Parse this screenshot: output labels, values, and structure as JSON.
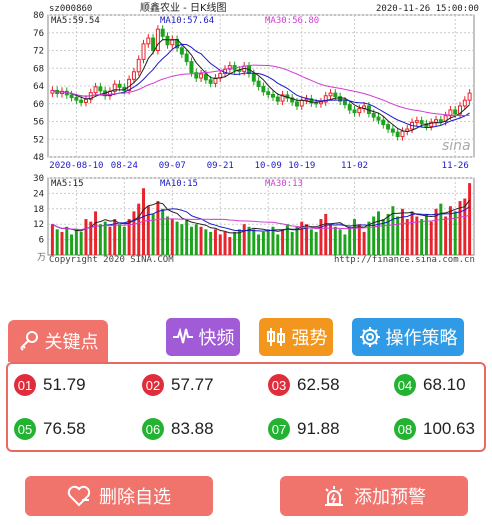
{
  "chart": {
    "symbol": "sz000860",
    "title": "顺鑫农业 - 日K线图",
    "datetime": "2020-11-26 15:00:00",
    "ma5_label": "MA5:59.54",
    "ma10_label": "MA10:57.64",
    "ma30_label": "MA30:56.80",
    "vol_ma5_label": "MA5:15",
    "vol_ma10_label": "MA10:15",
    "vol_ma30_label": "MA30:13",
    "vol_unit": "万",
    "copyright": "Copyright 2020 SINA.COM",
    "source_url": "http://finance.sina.com.cn",
    "watermark": "sina",
    "price_ticks": [
      "80",
      "76",
      "72",
      "68",
      "64",
      "60",
      "56",
      "52",
      "48"
    ],
    "volume_ticks": [
      "30",
      "24",
      "18",
      "12",
      "6"
    ],
    "date_ticks": [
      "2020-08-10",
      "08-24",
      "09-07",
      "09-21",
      "10-09",
      "10-19",
      "11-02",
      "11-26"
    ],
    "colors": {
      "up": "#e8232b",
      "down": "#1ca21c",
      "ma5": "#222222",
      "ma10": "#1a1ac8",
      "ma30": "#d23cd2"
    }
  },
  "chart_data": {
    "type": "candlestick",
    "title": "顺鑫农业 - 日K线图",
    "ylim_price": [
      48,
      80
    ],
    "ylim_volume": [
      0,
      30
    ],
    "close": [
      63.0,
      62.3,
      62.8,
      62.0,
      61.4,
      60.8,
      60.3,
      61.0,
      62.5,
      63.8,
      62.9,
      61.8,
      62.8,
      64.4,
      63.7,
      63.0,
      65.5,
      67.2,
      70.0,
      73.5,
      74.8,
      72.0,
      76.8,
      75.2,
      73.3,
      74.5,
      72.6,
      71.2,
      69.5,
      67.0,
      65.8,
      66.7,
      65.4,
      64.6,
      65.8,
      66.8,
      67.8,
      68.6,
      67.6,
      67.3,
      68.5,
      66.8,
      65.1,
      63.9,
      62.7,
      62.1,
      61.5,
      60.6,
      62.0,
      61.3,
      60.4,
      59.5,
      60.8,
      61.1,
      60.2,
      60.0,
      60.4,
      61.8,
      62.4,
      61.6,
      60.6,
      59.8,
      58.6,
      58.0,
      58.9,
      59.5,
      57.8,
      57.0,
      56.3,
      55.3,
      54.3,
      53.6,
      52.6,
      53.8,
      54.3,
      55.8,
      56.2,
      55.5,
      54.9,
      55.8,
      56.4,
      56.0,
      57.3,
      58.6,
      57.7,
      59.5,
      60.8,
      62.4
    ],
    "volume": [
      12,
      10,
      9,
      11,
      8,
      10,
      9,
      14,
      13,
      17,
      12,
      13,
      11,
      14,
      12,
      11,
      14,
      17,
      20,
      26,
      19,
      16,
      21,
      18,
      15,
      14,
      13,
      12,
      14,
      11,
      12,
      11,
      10,
      9,
      10,
      8,
      9,
      7,
      9,
      10,
      12,
      11,
      10,
      8,
      9,
      10,
      11,
      8,
      10,
      12,
      9,
      11,
      13,
      12,
      10,
      9,
      14,
      16,
      12,
      11,
      10,
      8,
      11,
      14,
      12,
      9,
      13,
      15,
      17,
      14,
      16,
      19,
      15,
      18,
      14,
      17,
      15,
      14,
      16,
      13,
      18,
      20,
      15,
      19,
      17,
      21,
      22,
      28
    ],
    "ma5_last": 59.54,
    "ma10_last": 57.64,
    "ma30_last": 56.8,
    "vol_ma5_last": 15,
    "vol_ma10_last": 15,
    "vol_ma30_last": 13
  },
  "tabs": {
    "key_points": "关键点",
    "fast_freq": "快频",
    "strength": "强势",
    "strategy": "操作策略"
  },
  "levels": [
    {
      "num": "01",
      "value": "51.79",
      "color": "red"
    },
    {
      "num": "02",
      "value": "57.77",
      "color": "red"
    },
    {
      "num": "03",
      "value": "62.58",
      "color": "red"
    },
    {
      "num": "04",
      "value": "68.10",
      "color": "green"
    },
    {
      "num": "05",
      "value": "76.58",
      "color": "green"
    },
    {
      "num": "06",
      "value": "83.88",
      "color": "green"
    },
    {
      "num": "07",
      "value": "91.88",
      "color": "green"
    },
    {
      "num": "08",
      "value": "100.63",
      "color": "green"
    }
  ],
  "buttons": {
    "remove_watchlist": "删除自选",
    "add_alert": "添加预警"
  }
}
